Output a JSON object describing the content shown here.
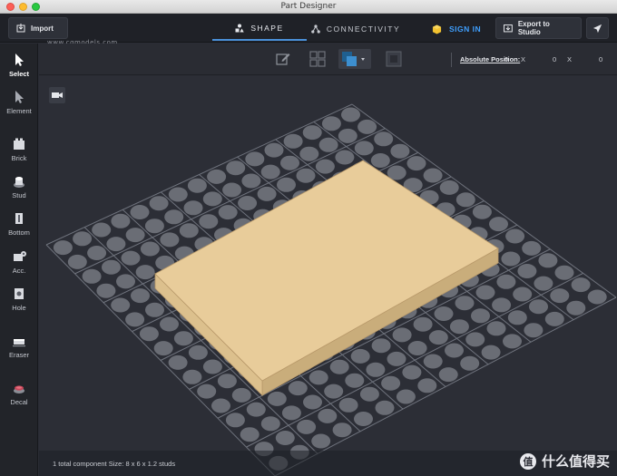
{
  "window": {
    "title": "Part Designer"
  },
  "topbar": {
    "import_label": "Import",
    "watermark": "www.cgmodels.com",
    "tabs": [
      {
        "label": "SHAPE",
        "icon": "shape-icon",
        "active": true
      },
      {
        "label": "CONNECTIVITY",
        "icon": "connectivity-icon",
        "active": false
      }
    ],
    "signin_label": "SIGN IN",
    "export_label": "Export to Studio",
    "accent": "#3fa0ff"
  },
  "tools": [
    {
      "label": "Select",
      "icon": "cursor-icon",
      "selected": true
    },
    {
      "label": "Element",
      "icon": "element-cursor-icon"
    },
    {
      "label": "Brick",
      "icon": "brick-icon"
    },
    {
      "label": "Stud",
      "icon": "stud-icon"
    },
    {
      "label": "Bottom",
      "icon": "bottom-icon"
    },
    {
      "label": "Acc.",
      "icon": "accessory-icon"
    },
    {
      "label": "Hole",
      "icon": "hole-icon"
    },
    {
      "label": "Eraser",
      "icon": "eraser-icon"
    },
    {
      "label": "Decal",
      "icon": "decal-icon"
    }
  ],
  "toolbar2": {
    "abs_label": "Absolute Position:",
    "coords": [
      {
        "value": "0",
        "axis": "X"
      },
      {
        "value": "0",
        "axis": "X"
      },
      {
        "value": "0",
        "axis": ""
      }
    ]
  },
  "status": {
    "text": "1 total component   Size: 8 x 6 x 1.2 studs"
  },
  "logo": {
    "badge": "值",
    "text": "什么值得买"
  },
  "colors": {
    "brick": "#e8cc9a",
    "grid_line": "#6f737d",
    "stud": "#6a6d75"
  }
}
